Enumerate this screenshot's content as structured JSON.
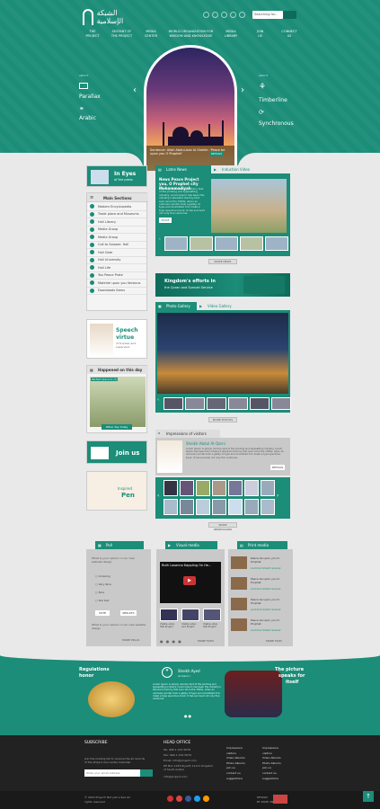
{
  "header": {
    "logo_text": "الشبكة الإسلامية",
    "search_placeholder": "Searching for...",
    "nav": [
      {
        "line1": "THE",
        "line2": "PROJECT"
      },
      {
        "line1": "SEXTANT OF",
        "line2": "THE PROJECT"
      },
      {
        "line1": "MEDIA",
        "line2": "CENTER"
      },
      {
        "line1": "WORLD ORGANIZATION FOR",
        "line2": "WISDOM AND KNOWLEDGE"
      },
      {
        "line1": "MEDIA",
        "line2": "LIBRARY"
      },
      {
        "line1": "JOIN",
        "line2": "US"
      },
      {
        "line1": "CONNECT",
        "line2": "US"
      }
    ]
  },
  "hero": {
    "left_small": "ABOUT",
    "left_label1": "Parallax",
    "left_label2": "Arabic",
    "right_small": "ABOUT",
    "right_label1": "Timberline",
    "right_label2": "Synchronous",
    "caption": "Sentence: Allah Abdul-Aziz Al-Sheikh: 'Peace be upon you O Prophet'",
    "caption_btn": "DETAILS",
    "prev": "‹",
    "next": "›"
  },
  "press": {
    "title1": "In Eyes",
    "title2": "of the press"
  },
  "main_sections": {
    "title": "Main Sections",
    "items": [
      "Madam Encyclopedia",
      "Trade place and Museums",
      "Hall Library",
      "Media Group",
      "Media Group",
      "Call to Salaam: Hall",
      "Hall Gate",
      "Hall University",
      "Hall Life",
      "You Peace Prate",
      "Materiel upon you Versions",
      "Downloads Items"
    ]
  },
  "speech": {
    "title1": "Speech",
    "title2": "virtue",
    "sub": "of founder and supervisor"
  },
  "happened": {
    "title": "Happened on this day",
    "caption": "Perfect place to (?)",
    "btn": "Other day today"
  },
  "join": {
    "label": "Join us"
  },
  "pen": {
    "label1": "Inspired",
    "label2": "Pen"
  },
  "news": {
    "tab1": "Lates News",
    "tab2": "Induction Video",
    "headline": "News Peace Project you, O Prophet city Mohammadiyah",
    "body": "Lorem Ipsum is simply dummy text of the printing and typesetting industry. Lorem Ipsum has been the industry's standard dummy text ever since the 1500s, when an unknown printer took a galley of type and scrambled it to make a type specimen book. It has survived not only five centuries.",
    "more_btn": "MORE",
    "more_link": "MORE NEWS"
  },
  "banner": {
    "line1": "Kingdom's efforts in",
    "line2": "the Quran and Sunnah Service"
  },
  "gallery": {
    "tab1": "Photo Gallery",
    "tab2": "Video Gallery",
    "more": "MORE PHOTOS"
  },
  "impressions": {
    "title": "Impressions of visitors",
    "name": "Sheikh Abdul Al-Qarni",
    "body": "Lorem Ipsum is simply dummy text of the printing and typesetting industry. Lorem Ipsum has been the industry's standard dummy text ever since the 1500s, when an unknown printer took a galley of type and scrambled it to make a type specimen book. It has survived not only five centuries.",
    "btn": "DETAILS",
    "more": "MORE IMPRESSIONS"
  },
  "poll": {
    "title": "Poll",
    "question": "What is your opinion in our new website design",
    "options": [
      "Amazing",
      "Very Nice",
      "Nice",
      "Not bad"
    ],
    "vote": "VOTE",
    "results": "RESULTS",
    "question2": "What is your opinion in our new website design",
    "more": "MORE POLLS"
  },
  "visual": {
    "title": "Visual media",
    "video_title": "Ruth Losanno Kappling On He...",
    "captions": [
      "Visible video Hall Project",
      "Visible video and Project",
      "Visible video Hall Project"
    ],
    "more": "MORE FILES"
  },
  "print": {
    "title": "Print media",
    "items": [
      {
        "title": "Peace be upon you O Prophet",
        "by": "Al-Ahmari Sheikh General"
      },
      {
        "title": "Peace be upon you O Prophet",
        "by": "Al-Ahmari Sheikh General"
      },
      {
        "title": "Peace be upon you O Prophet",
        "by": "Al-Ahmari Sheikh General"
      },
      {
        "title": "Peace be upon you O Prophet",
        "by": "Al-Ahmari Sheikh General"
      }
    ],
    "more": "MORE FILES"
  },
  "band": {
    "left1": "Regulations",
    "left2": "honor",
    "center_name": "Sheikh Ayed",
    "center_sub": "Al-Qarni r",
    "center_body": "Lorem Ipsum is simply dummy text of the printing and typesetting industry. Lorem Ipsum has been the industry's standard dummy text ever since the 1500s, when an unknown printer took a galley of type and scrambled it to make a type specimen book. It has survived not only five centuries.",
    "right1": "The picture",
    "right2": "speaks for",
    "right3": "itself"
  },
  "footer": {
    "subscribe_title": "SUBSCRIBE",
    "subscribe_text": "Join the mailing list to receive the all records of the Project and center Calendar",
    "email_placeholder": "Write your email address",
    "office_title": "HEAD OFFICE",
    "office_lines": [
      "Tel: 966 1 234 5678",
      "Fax: 966 1 234 5679",
      "Email: info@project.com",
      "PO Box 1234 Riyadh 11111 Kingdom of Saudi Arabia",
      "info@project.com"
    ],
    "links_col1": [
      "Impressions",
      "visitors",
      "Video Albums",
      "Photo Albums",
      "join us",
      "contact us",
      "suggestions"
    ],
    "links_col2": [
      "Impressions",
      "visitors",
      "Video Albums",
      "Photo Albums",
      "join us",
      "contact us",
      "suggestions"
    ],
    "copyright1": "© 2014 Project! Not just a Sea All",
    "copyright2": "rights reserved",
    "credit1": "DESIGN",
    "credit2": "BY ROSE ANGELIA"
  },
  "colors": {
    "primary": "#1b8d78",
    "dark": "#222222"
  }
}
